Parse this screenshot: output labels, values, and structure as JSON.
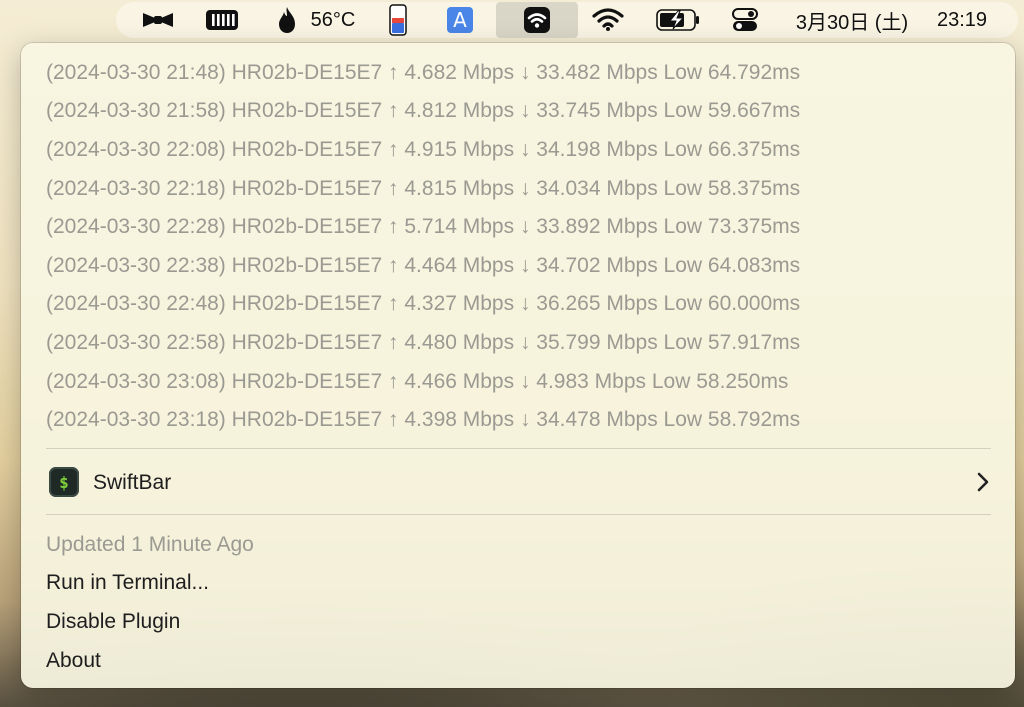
{
  "menubar": {
    "temperature": "56°C",
    "date": "3月30日 (土)",
    "time": "23:19",
    "input_source": "A",
    "icons": [
      "bartender-icon",
      "ram-meter-icon",
      "flame-icon",
      "battery-gauge-icon",
      "input-source-icon",
      "swiftbar-wifi-icon",
      "wifi-icon",
      "battery-icon",
      "control-center-icon"
    ]
  },
  "menu": {
    "log_lines": [
      "(2024-03-30 21:48) HR02b-DE15E7 ↑ 4.682 Mbps ↓ 33.482 Mbps Low 64.792ms",
      "(2024-03-30 21:58) HR02b-DE15E7 ↑ 4.812 Mbps ↓ 33.745 Mbps Low 59.667ms",
      "(2024-03-30 22:08) HR02b-DE15E7 ↑ 4.915 Mbps ↓ 34.198 Mbps Low 66.375ms",
      "(2024-03-30 22:18) HR02b-DE15E7 ↑ 4.815 Mbps ↓ 34.034 Mbps Low 58.375ms",
      "(2024-03-30 22:28) HR02b-DE15E7 ↑ 5.714 Mbps ↓ 33.892 Mbps Low 73.375ms",
      "(2024-03-30 22:38) HR02b-DE15E7 ↑ 4.464 Mbps ↓ 34.702 Mbps Low 64.083ms",
      "(2024-03-30 22:48) HR02b-DE15E7 ↑ 4.327 Mbps ↓ 36.265 Mbps Low 60.000ms",
      "(2024-03-30 22:58) HR02b-DE15E7 ↑ 4.480 Mbps ↓ 35.799 Mbps Low 57.917ms",
      "(2024-03-30 23:08) HR02b-DE15E7 ↑ 4.466 Mbps ↓ 4.983 Mbps Low 58.250ms",
      "(2024-03-30 23:18) HR02b-DE15E7 ↑ 4.398 Mbps ↓ 34.478 Mbps Low 58.792ms"
    ],
    "app_label": "SwiftBar",
    "app_icon_text": "$",
    "updated_label": "Updated 1 Minute Ago",
    "run_in_terminal": "Run in Terminal...",
    "disable_plugin": "Disable Plugin",
    "about": "About"
  },
  "colors": {
    "menu_bg": "#f8f5e1",
    "dim_text": "#9b9a92",
    "active_text": "#1e1e1e",
    "battery_red": "#e8473b",
    "battery_blue": "#3a6fe0",
    "input_source_blue": "#4a86e8",
    "swiftbar_green": "#7fd13b"
  }
}
